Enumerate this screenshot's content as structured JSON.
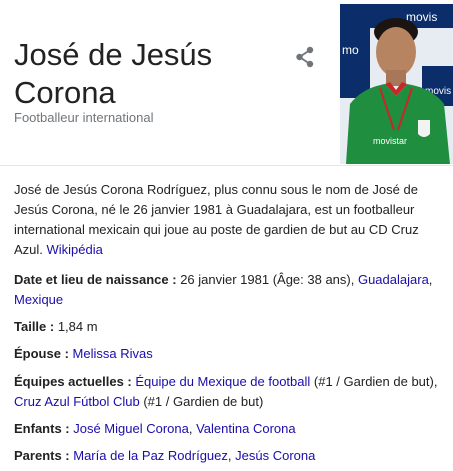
{
  "header": {
    "title_line1": "José de Jesús",
    "title_line2": "Corona",
    "subtitle": "Footballeur international",
    "share_icon": "share-icon",
    "photo": {
      "sponsor_top": "movis",
      "sponsor_mid": "mo",
      "sponsor_right": "movis",
      "shirt_logo": "movistar"
    }
  },
  "description": {
    "text": "José de Jesús Corona Rodríguez, plus connu sous le nom de José de Jesús Corona, né le 26 janvier 1981 à Guadalajara, est un footballeur international mexicain qui joue au poste de gardien de but au CD Cruz Azul. ",
    "source_link": "Wikipédia"
  },
  "facts": {
    "birth": {
      "label": "Date et lieu de naissance : ",
      "text": "26 janvier 1981 (Âge: 38 ans), ",
      "link1": "Guadalajara",
      "sep": ", ",
      "link2": "Mexique"
    },
    "height": {
      "label": "Taille : ",
      "value": "1,84 m"
    },
    "spouse": {
      "label": "Épouse : ",
      "link": "Melissa Rivas"
    },
    "teams": {
      "label": "Équipes actuelles : ",
      "link1": "Équipe du Mexique de football",
      "text1": " (#1 / Gardien de but), ",
      "link2": "Cruz Azul Fútbol Club",
      "text2": " (#1 / Gardien de but)"
    },
    "children": {
      "label": "Enfants : ",
      "link1": "José Miguel Corona",
      "sep": ", ",
      "link2": "Valentina Corona"
    },
    "parents": {
      "label": "Parents : ",
      "link1": "María de la Paz Rodríguez",
      "sep": ", ",
      "link2": "Jesús Corona"
    }
  },
  "colors": {
    "link": "#1a0dab",
    "text": "#222222",
    "muted": "#70757a",
    "shirt_green": "#1f8f3f",
    "sponsor_blue": "#0b2e6b"
  }
}
